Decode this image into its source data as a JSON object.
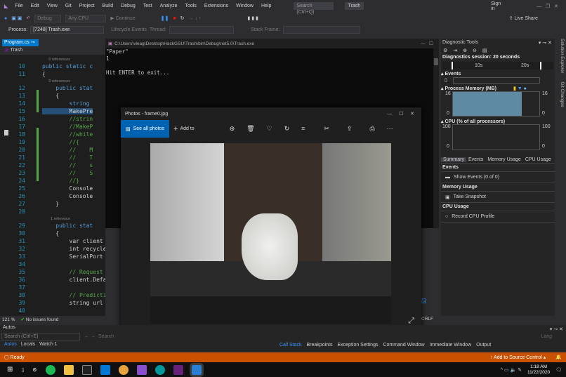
{
  "menu": {
    "items": [
      "File",
      "Edit",
      "View",
      "Git",
      "Project",
      "Build",
      "Debug",
      "Test",
      "Analyze",
      "Tools",
      "Extensions",
      "Window",
      "Help"
    ],
    "search_placeholder": "Search (Ctrl+Q)",
    "solution_name": "Trash",
    "sign_in": "Sign in",
    "live_share": "Live Share"
  },
  "toolbar": {
    "config": "Debug",
    "platform": "Any CPU",
    "continue": "Continue"
  },
  "process_bar": {
    "process_label": "Process:",
    "process_value": "[7248] Trash.exe",
    "lifecycle": "Lifecycle Events",
    "thread": "Thread:",
    "stack_frame": "Stack Frame:"
  },
  "editor": {
    "tab": "Program.cs",
    "nav": "Trash",
    "zoom": "121 %",
    "issues": "No issues found",
    "line_ending": "CRLF",
    "link_fragment": "73",
    "lines": [
      {
        "ref": "0 references"
      },
      {
        "n": "10",
        "t": "public static c",
        "c": "kw"
      },
      {
        "n": "11",
        "t": "{"
      },
      {
        "ref": "0 references"
      },
      {
        "n": "12",
        "t": "    public stat",
        "c": "kw"
      },
      {
        "n": "13",
        "t": "    {"
      },
      {
        "n": "14",
        "t": "        string",
        "c": "kw"
      },
      {
        "n": "15",
        "t": "        MakePre"
      },
      {
        "n": "16",
        "t": "        //strin",
        "c": "cm"
      },
      {
        "n": "17",
        "t": "        //MakeP",
        "c": "cm"
      },
      {
        "n": "18",
        "t": "        //while",
        "c": "cm"
      },
      {
        "n": "19",
        "t": "        //{",
        "c": "cm"
      },
      {
        "n": "20",
        "t": "        //    M",
        "c": "cm"
      },
      {
        "n": "21",
        "t": "        //    T",
        "c": "cm"
      },
      {
        "n": "22",
        "t": "        //    s",
        "c": "cm"
      },
      {
        "n": "23",
        "t": "        //    S",
        "c": "cm"
      },
      {
        "n": "24",
        "t": "        //}",
        "c": "cm"
      },
      {
        "n": "25",
        "t": "        Console"
      },
      {
        "n": "26",
        "t": "        Console"
      },
      {
        "n": "27",
        "t": "    }"
      },
      {
        "n": "28",
        "t": ""
      },
      {
        "ref": "1 reference"
      },
      {
        "n": "29",
        "t": "    public stat",
        "c": "kw"
      },
      {
        "n": "30",
        "t": "    {"
      },
      {
        "n": "31",
        "t": "        var client ="
      },
      {
        "n": "32",
        "t": "        int recycle"
      },
      {
        "n": "33",
        "t": "        SerialPort p"
      },
      {
        "n": "34",
        "t": ""
      },
      {
        "n": "35",
        "t": "        // Request h",
        "c": "cm"
      },
      {
        "n": "36",
        "t": "        client.Defau"
      },
      {
        "n": "37",
        "t": ""
      },
      {
        "n": "38",
        "t": "        // Predictio",
        "c": "cm"
      },
      {
        "n": "39",
        "t": "        string url ="
      },
      {
        "n": "40",
        "t": ""
      }
    ]
  },
  "console": {
    "title": "C:\\Users\\vleag\\Desktop\\HackGSU\\Trash\\bin\\Debug\\net5.0\\Trash.exe",
    "lines": [
      "\"Paper\"",
      "1",
      "",
      "Hit ENTER to exit..."
    ]
  },
  "photos": {
    "title": "Photos - frame0.jpg",
    "see_all": "See all photos",
    "add_to": "Add to"
  },
  "diagnostics": {
    "title": "Diagnostic Tools",
    "session": "Diagnostics session: 20 seconds",
    "ticks": [
      "10s",
      "20s"
    ],
    "events": "Events",
    "memory": "Process Memory (MB)",
    "mem_max": "16",
    "mem_min": "0",
    "mem_fill": 0.8,
    "cpu": "CPU (% of all processors)",
    "cpu_max": "100",
    "cpu_min": "0",
    "tabs": [
      "Summary",
      "Events",
      "Memory Usage",
      "CPU Usage"
    ],
    "sections": [
      {
        "h": "Events",
        "a": "Show Events (0 of 0)"
      },
      {
        "h": "Memory Usage",
        "a": "Take Snapshot"
      },
      {
        "h": "CPU Usage",
        "a": "Record CPU Profile"
      }
    ]
  },
  "side_tabs": [
    "Solution Explorer",
    "Git Changes"
  ],
  "autos": {
    "title": "Autos",
    "search": "Search (Ctrl+E)",
    "search2": "Search",
    "lang": "Lang",
    "tabs": [
      "Autos",
      "Locals",
      "Watch 1"
    ]
  },
  "bottom_tabs": [
    "Call Stack",
    "Breakpoints",
    "Exception Settings",
    "Command Window",
    "Immediate Window",
    "Output"
  ],
  "status": {
    "ready": "Ready",
    "source_control": "Add to Source Control"
  },
  "taskbar": {
    "time": "1:18 AM",
    "date": "11/22/2020"
  },
  "colors": {
    "accent": "#ca5100",
    "blue": "#0063b1"
  }
}
